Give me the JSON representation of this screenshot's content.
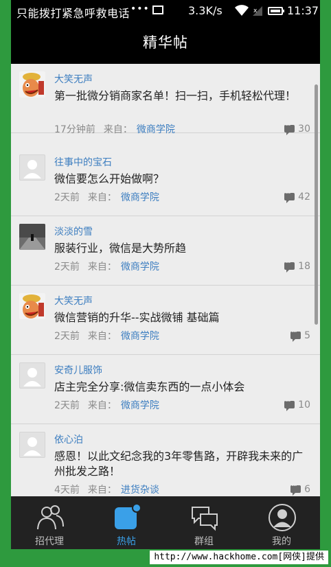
{
  "statusbar": {
    "carrier": "只能拨打紧急呼救电话",
    "dots": "•••",
    "speed": "3.3K/s",
    "time": "11:37"
  },
  "header": {
    "title": "精华帖"
  },
  "posts": [
    {
      "author": "大笑无声",
      "title": "第一批微分销商家名单！扫一扫，手机轻松代理！",
      "time": "17分钟前",
      "from_label": "来自：",
      "board": "微商学院",
      "replies": "30",
      "avatar": "cartoon-avatar"
    },
    {
      "author": "往事中的宝石",
      "title": "微信要怎么开始做啊？",
      "time": "2天前",
      "from_label": "来自：",
      "board": "微商学院",
      "replies": "42",
      "avatar": "default-avatar"
    },
    {
      "author": "淡淡的雪",
      "title": "服装行业，微信是大势所趋",
      "time": "2天前",
      "from_label": "来自：",
      "board": "微商学院",
      "replies": "18",
      "avatar": "photo-avatar"
    },
    {
      "author": "大笑无声",
      "title": "微信营销的升华--实战微铺 基础篇",
      "time": "2天前",
      "from_label": "来自：",
      "board": "微商学院",
      "replies": "5",
      "avatar": "cartoon-avatar"
    },
    {
      "author": "安奇儿服饰",
      "title": "店主完全分享:微信卖东西的一点小体会",
      "time": "2天前",
      "from_label": "来自：",
      "board": "微商学院",
      "replies": "10",
      "avatar": "default-avatar"
    },
    {
      "author": "依心泊",
      "title": "感恩！以此文纪念我的3年零售路，开辟我未来的广州批发之路！",
      "time": "4天前",
      "from_label": "来自：",
      "board": "进货杂谈",
      "replies": "6",
      "avatar": "default-avatar"
    }
  ],
  "tabs": [
    {
      "label": "招代理",
      "icon": "people-icon"
    },
    {
      "label": "热帖",
      "icon": "hot-post-icon"
    },
    {
      "label": "群组",
      "icon": "chat-bubbles-icon"
    },
    {
      "label": "我的",
      "icon": "user-icon"
    }
  ],
  "footer": {
    "text": "http://www.hackhome.com[网侠]提供"
  },
  "colors": {
    "accent": "#3aa0e8",
    "link": "#3d7ec0",
    "bar": "#000000",
    "tabbar": "#222222",
    "frame": "#2e9a3e"
  }
}
